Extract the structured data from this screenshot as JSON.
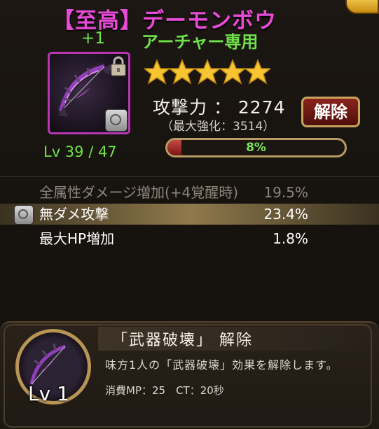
{
  "item": {
    "title": "【至高】デーモンボウ",
    "plus": "+1",
    "restriction": "アーチャー専用",
    "stars": 5,
    "attack_line": "攻撃力 ： 2274",
    "max_enhance": "（最大強化：3514）",
    "level": "Lv 39 / 47",
    "progress_percent": 8,
    "progress_label": "8%",
    "unlock_button": "解除",
    "icon": "demon-bow-icon",
    "lock_icon": "padlock-icon"
  },
  "stats": [
    {
      "label": "全属性ダメージ増加(+4覚醒時)",
      "value": "19.5%",
      "dimmed": true
    },
    {
      "label": "無ダメ攻撃",
      "value": "23.4%",
      "highlighted": true
    },
    {
      "label": "最大HP増加",
      "value": "1.8%"
    }
  ],
  "skill": {
    "name": "「武器破壊」 解除",
    "level": "Lv 1",
    "description": "味方1人の「武器破壊」効果を解除します。",
    "stats": "消費MP：25　CT：20秒"
  },
  "colors": {
    "title": "#e84bd8",
    "green": "#6fe14a",
    "gold": "#f7c531",
    "accent_red": "#8b241c"
  }
}
